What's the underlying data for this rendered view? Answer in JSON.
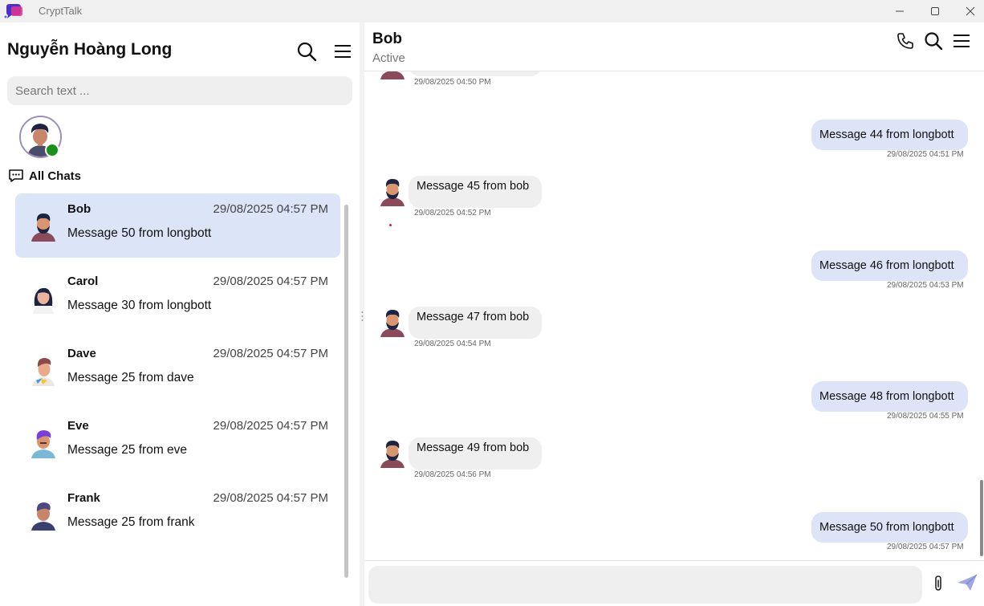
{
  "window": {
    "title": "CryptTalk"
  },
  "sidebar": {
    "user_name": "Nguyễn Hoàng Long",
    "search": {
      "placeholder": "Search text ...",
      "value": ""
    },
    "section_title": "All Chats",
    "chats": [
      {
        "name": "Bob",
        "time": "29/08/2025 04:57 PM",
        "preview": "Message 50 from longbott",
        "active": true
      },
      {
        "name": "Carol",
        "time": "29/08/2025 04:57 PM",
        "preview": "Message 30 from longbott",
        "active": false
      },
      {
        "name": "Dave",
        "time": "29/08/2025 04:57 PM",
        "preview": "Message 25 from dave",
        "active": false
      },
      {
        "name": "Eve",
        "time": "29/08/2025 04:57 PM",
        "preview": "Message 25 from eve",
        "active": false
      },
      {
        "name": "Frank",
        "time": "29/08/2025 04:57 PM",
        "preview": "Message 25 from frank",
        "active": false
      }
    ]
  },
  "conversation": {
    "contact_name": "Bob",
    "status": "Active",
    "messages": [
      {
        "direction": "in",
        "text": "",
        "time": "29/08/2025 04:50 PM"
      },
      {
        "direction": "out",
        "text": "Message 44 from longbott",
        "time": "29/08/2025 04:51 PM"
      },
      {
        "direction": "in",
        "text": "Message 45 from bob",
        "time": "29/08/2025 04:52 PM"
      },
      {
        "direction": "out",
        "text": "Message 46 from longbott",
        "time": "29/08/2025 04:53 PM"
      },
      {
        "direction": "in",
        "text": "Message 47 from bob",
        "time": "29/08/2025 04:54 PM"
      },
      {
        "direction": "out",
        "text": "Message 48 from longbott",
        "time": "29/08/2025 04:55 PM"
      },
      {
        "direction": "in",
        "text": "Message 49 from bob",
        "time": "29/08/2025 04:56 PM"
      },
      {
        "direction": "out",
        "text": "Message 50 from longbott",
        "time": "29/08/2025 04:57 PM"
      }
    ],
    "composer": {
      "placeholder": "",
      "value": ""
    }
  },
  "colors": {
    "active_chat_bg": "#dce4f8",
    "outgoing_bubble": "#dde4f7",
    "incoming_bubble": "#efefef",
    "online": "#1a8f1a"
  },
  "icons": [
    "app-logo",
    "search-icon",
    "menu-icon",
    "chat-bubble-icon",
    "phone-icon",
    "paperclip-icon",
    "send-icon",
    "minimize-icon",
    "maximize-icon",
    "close-icon"
  ]
}
